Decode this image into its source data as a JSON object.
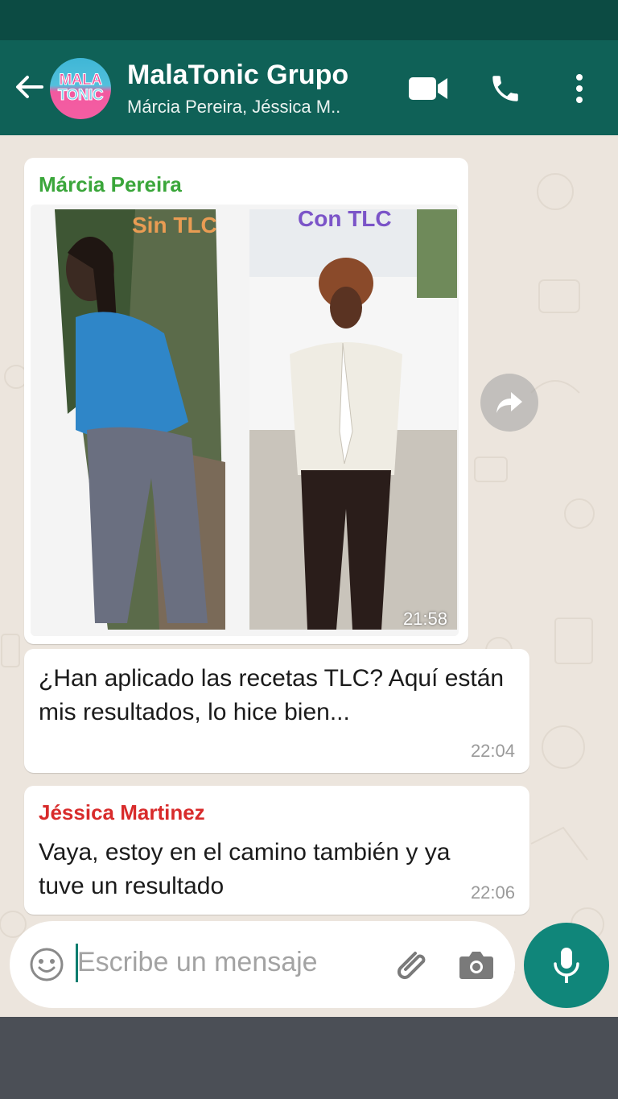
{
  "header": {
    "avatar_line1": "MALA",
    "avatar_line2": "TONIC",
    "title": "MalaTonic Grupo",
    "subtitle": "Márcia Pereira, Jéssica M..",
    "back_icon": "arrow-back-icon",
    "video_icon": "video-call-icon",
    "call_icon": "phone-icon",
    "menu_icon": "more-vert-icon"
  },
  "messages": [
    {
      "sender": "Márcia Pereira",
      "sender_color": "#3aa63a",
      "photo_label_left": "Sin TLC",
      "photo_label_right": "Con TLC",
      "time": "21:58"
    },
    {
      "text": "¿Han aplicado las recetas TLC? Aquí están mis resultados, lo hice bien...",
      "time": "22:04"
    },
    {
      "sender": "Jéssica Martinez",
      "sender_color": "#d82b2b",
      "text": "Vaya, estoy en el camino también y ya tuve un resultado",
      "time": "22:06"
    }
  ],
  "input": {
    "placeholder": "Escribe un mensaje",
    "emoji_icon": "emoji-icon",
    "attach_icon": "paperclip-icon",
    "camera_icon": "camera-icon",
    "mic_icon": "microphone-icon"
  },
  "colors": {
    "header": "#0f6157",
    "statusbar": "#0c4b43",
    "accent": "#10867a",
    "chat_bg": "#ece5dd"
  }
}
